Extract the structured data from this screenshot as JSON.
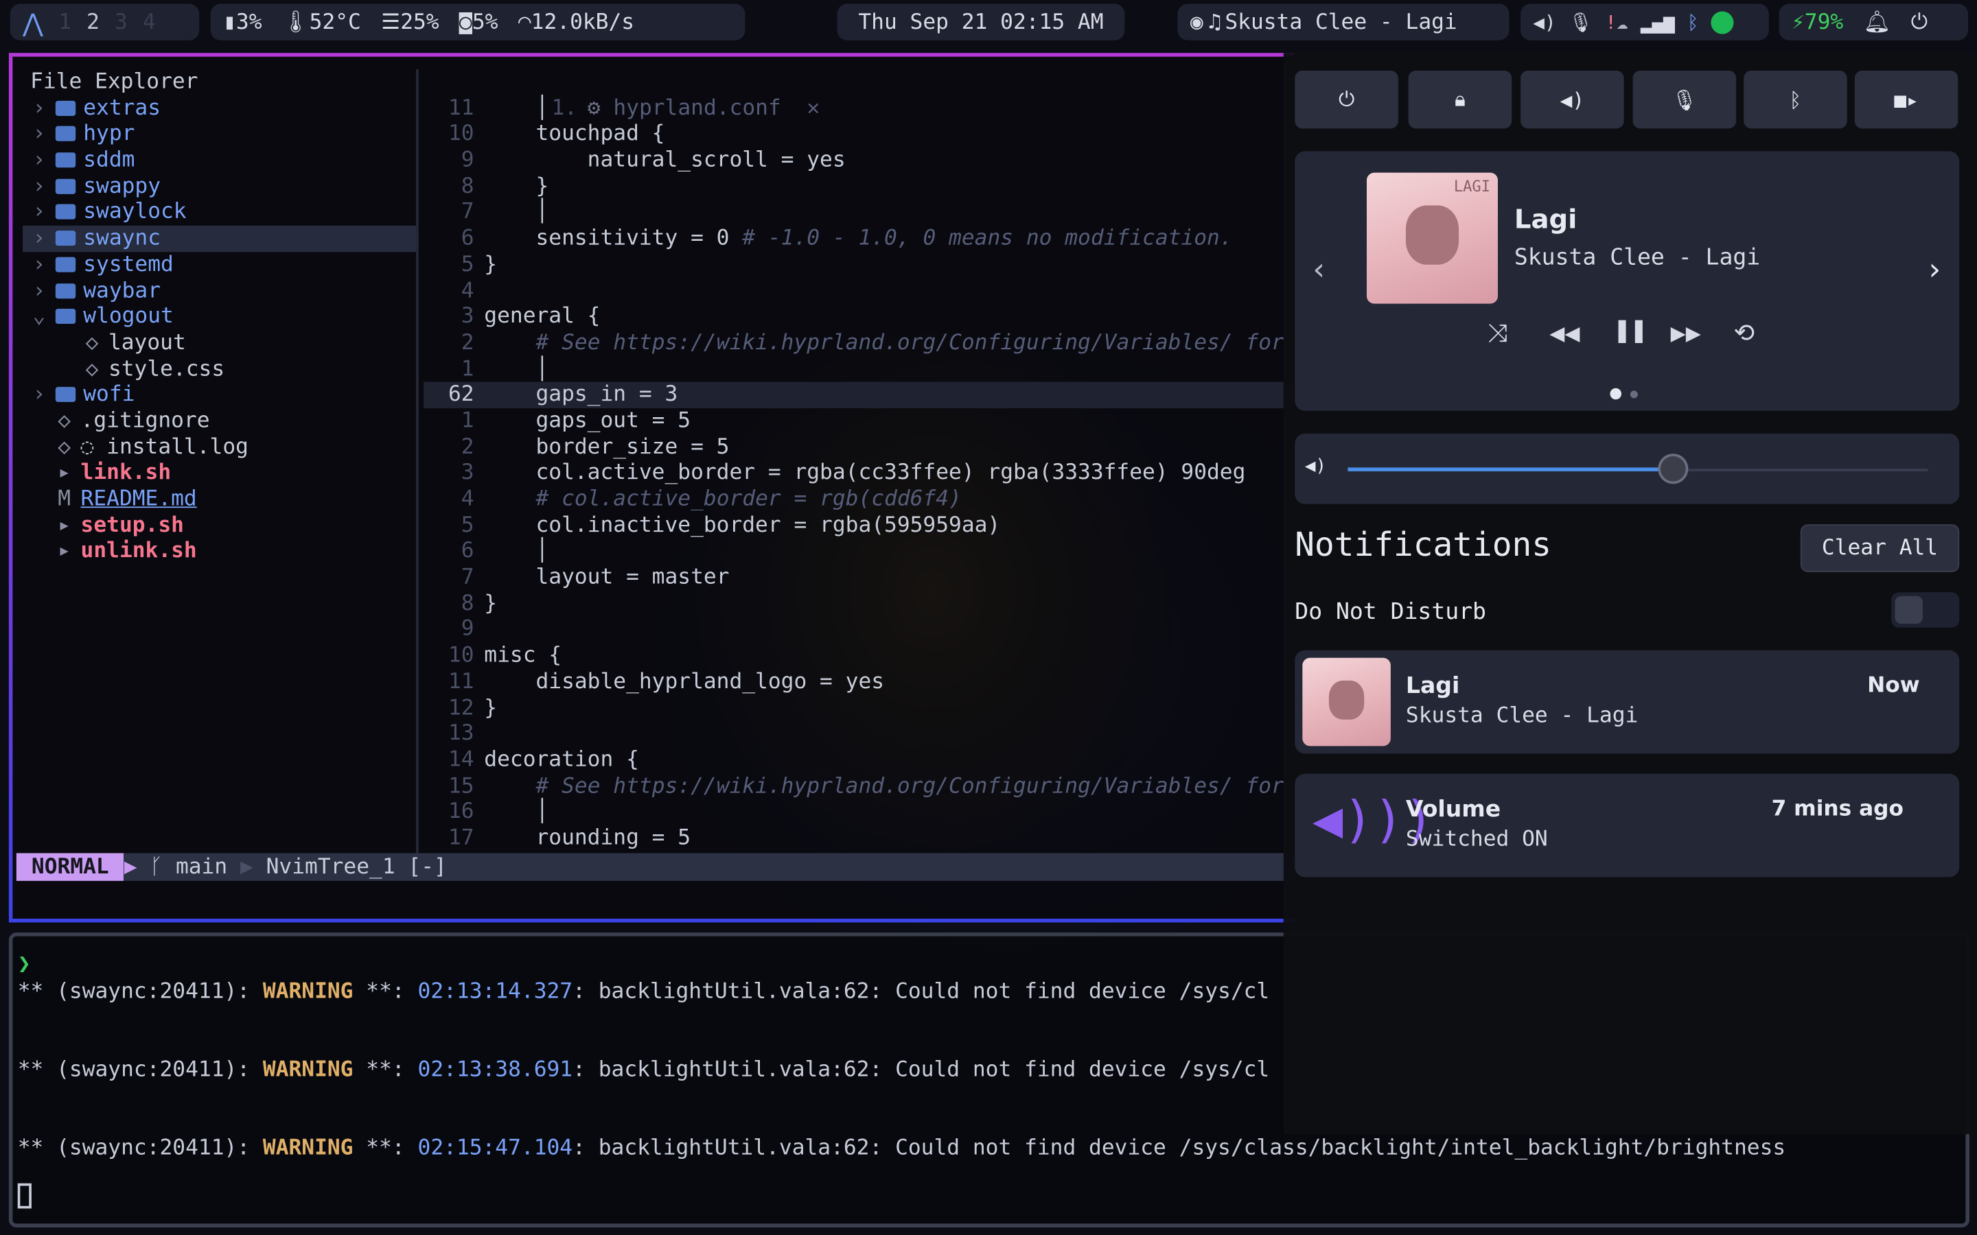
{
  "topbar": {
    "workspaces": [
      "1",
      "2",
      "3",
      "4"
    ],
    "active_workspace": "2",
    "cpu": "3%",
    "temp": "52°C",
    "memory": "25%",
    "disk": "5%",
    "network": "12.0kB/s",
    "clock": "Thu Sep 21 02:15 AM",
    "media": "Skusta Clee - Lagi",
    "battery": "79%"
  },
  "explorer": {
    "header": "File Explorer",
    "items": [
      {
        "name": "extras",
        "type": "dir",
        "fold": "›"
      },
      {
        "name": "hypr",
        "type": "dir",
        "fold": "›"
      },
      {
        "name": "sddm",
        "type": "dir",
        "fold": "›"
      },
      {
        "name": "swappy",
        "type": "dir",
        "fold": "›"
      },
      {
        "name": "swaylock",
        "type": "dir",
        "fold": "›"
      },
      {
        "name": "swaync",
        "type": "dir",
        "fold": "›"
      },
      {
        "name": "systemd",
        "type": "dir",
        "fold": "›"
      },
      {
        "name": "waybar",
        "type": "dir",
        "fold": "›"
      },
      {
        "name": "wlogout",
        "type": "dir",
        "fold": "⌄"
      },
      {
        "name": "layout",
        "type": "file"
      },
      {
        "name": "style.css",
        "type": "file"
      },
      {
        "name": "wofi",
        "type": "dir",
        "fold": "›"
      },
      {
        "name": ".gitignore",
        "type": "file"
      },
      {
        "name": "◌ install.log",
        "type": "file"
      },
      {
        "name": "link.sh",
        "type": "script"
      },
      {
        "name": "README.md",
        "type": "md"
      },
      {
        "name": "setup.sh",
        "type": "script"
      },
      {
        "name": "unlink.sh",
        "type": "script"
      }
    ]
  },
  "editor": {
    "tab": "hyprland.conf",
    "tab_num": "1.",
    "lines": [
      {
        "n": "11",
        "t": "    │"
      },
      {
        "n": "10",
        "t": "    touchpad {"
      },
      {
        "n": "9",
        "t": "        natural_scroll = yes"
      },
      {
        "n": "8",
        "t": "    }"
      },
      {
        "n": "7",
        "t": "    │"
      },
      {
        "n": "6",
        "t": "    sensitivity = 0 ",
        "c": "# -1.0 - 1.0, 0 means no modification."
      },
      {
        "n": "5",
        "t": "}"
      },
      {
        "n": "4",
        "t": ""
      },
      {
        "n": "3",
        "t": "general {"
      },
      {
        "n": "2",
        "t": "    ",
        "c": "# See https://wiki.hyprland.org/Configuring/Variables/ for"
      },
      {
        "n": "1",
        "t": "    │"
      },
      {
        "n": "62",
        "t": "    gaps_in = 3"
      },
      {
        "n": "1",
        "t": "    gaps_out = 5"
      },
      {
        "n": "2",
        "t": "    border_size = 5"
      },
      {
        "n": "3",
        "t": "    col.active_border = rgba(cc33ffee) rgba(3333ffee) 90deg"
      },
      {
        "n": "4",
        "t": "    ",
        "c": "# col.active_border = rgb(cdd6f4)"
      },
      {
        "n": "5",
        "t": "    col.inactive_border = rgba(595959aa)"
      },
      {
        "n": "6",
        "t": "    │"
      },
      {
        "n": "7",
        "t": "    layout = master"
      },
      {
        "n": "8",
        "t": "}"
      },
      {
        "n": "9",
        "t": ""
      },
      {
        "n": "10",
        "t": "misc {"
      },
      {
        "n": "11",
        "t": "    disable_hyprland_logo = yes"
      },
      {
        "n": "12",
        "t": "}"
      },
      {
        "n": "13",
        "t": ""
      },
      {
        "n": "14",
        "t": "decoration {"
      },
      {
        "n": "15",
        "t": "    ",
        "c": "# See https://wiki.hyprland.org/Configuring/Variables/ for"
      },
      {
        "n": "16",
        "t": "    │"
      },
      {
        "n": "17",
        "t": "    rounding = 5"
      }
    ],
    "status_mode": "NORMAL",
    "status_branch": "main",
    "status_file": "NvimTree_1 [-]"
  },
  "terminal": {
    "prompt": "❯",
    "lines": [
      {
        "pre": "** (swaync:20411): ",
        "warn": "WARNING",
        "mid": " **: ",
        "ts": "02:13:14.327",
        "msg": ": backlightUtil.vala:62: Could not find device /sys/cl"
      },
      {
        "pre": "** (swaync:20411): ",
        "warn": "WARNING",
        "mid": " **: ",
        "ts": "02:13:38.691",
        "msg": ": backlightUtil.vala:62: Could not find device /sys/cl"
      },
      {
        "pre": "** (swaync:20411): ",
        "warn": "WARNING",
        "mid": " **: ",
        "ts": "02:15:47.104",
        "msg": ": backlightUtil.vala:62: Could not find device /sys/class/backlight/intel_backlight/brightness"
      }
    ]
  },
  "control_center": {
    "player": {
      "title": "Lagi",
      "artist": "Skusta Clee - Lagi",
      "art_text": "LAGI"
    },
    "volume_level": 0.56,
    "notifications_title": "Notifications",
    "clear_all": "Clear All",
    "dnd_label": "Do Not Disturb",
    "notifications": [
      {
        "title": "Lagi",
        "body": "Skusta Clee - Lagi",
        "time": "Now"
      },
      {
        "title": "Volume",
        "body": "Switched ON",
        "time": "7 mins ago"
      }
    ]
  },
  "colors": {
    "accent": "#8a3ad6",
    "blue": "#7aa2f7",
    "warning": "#e0af68",
    "script": "#f7768e"
  }
}
